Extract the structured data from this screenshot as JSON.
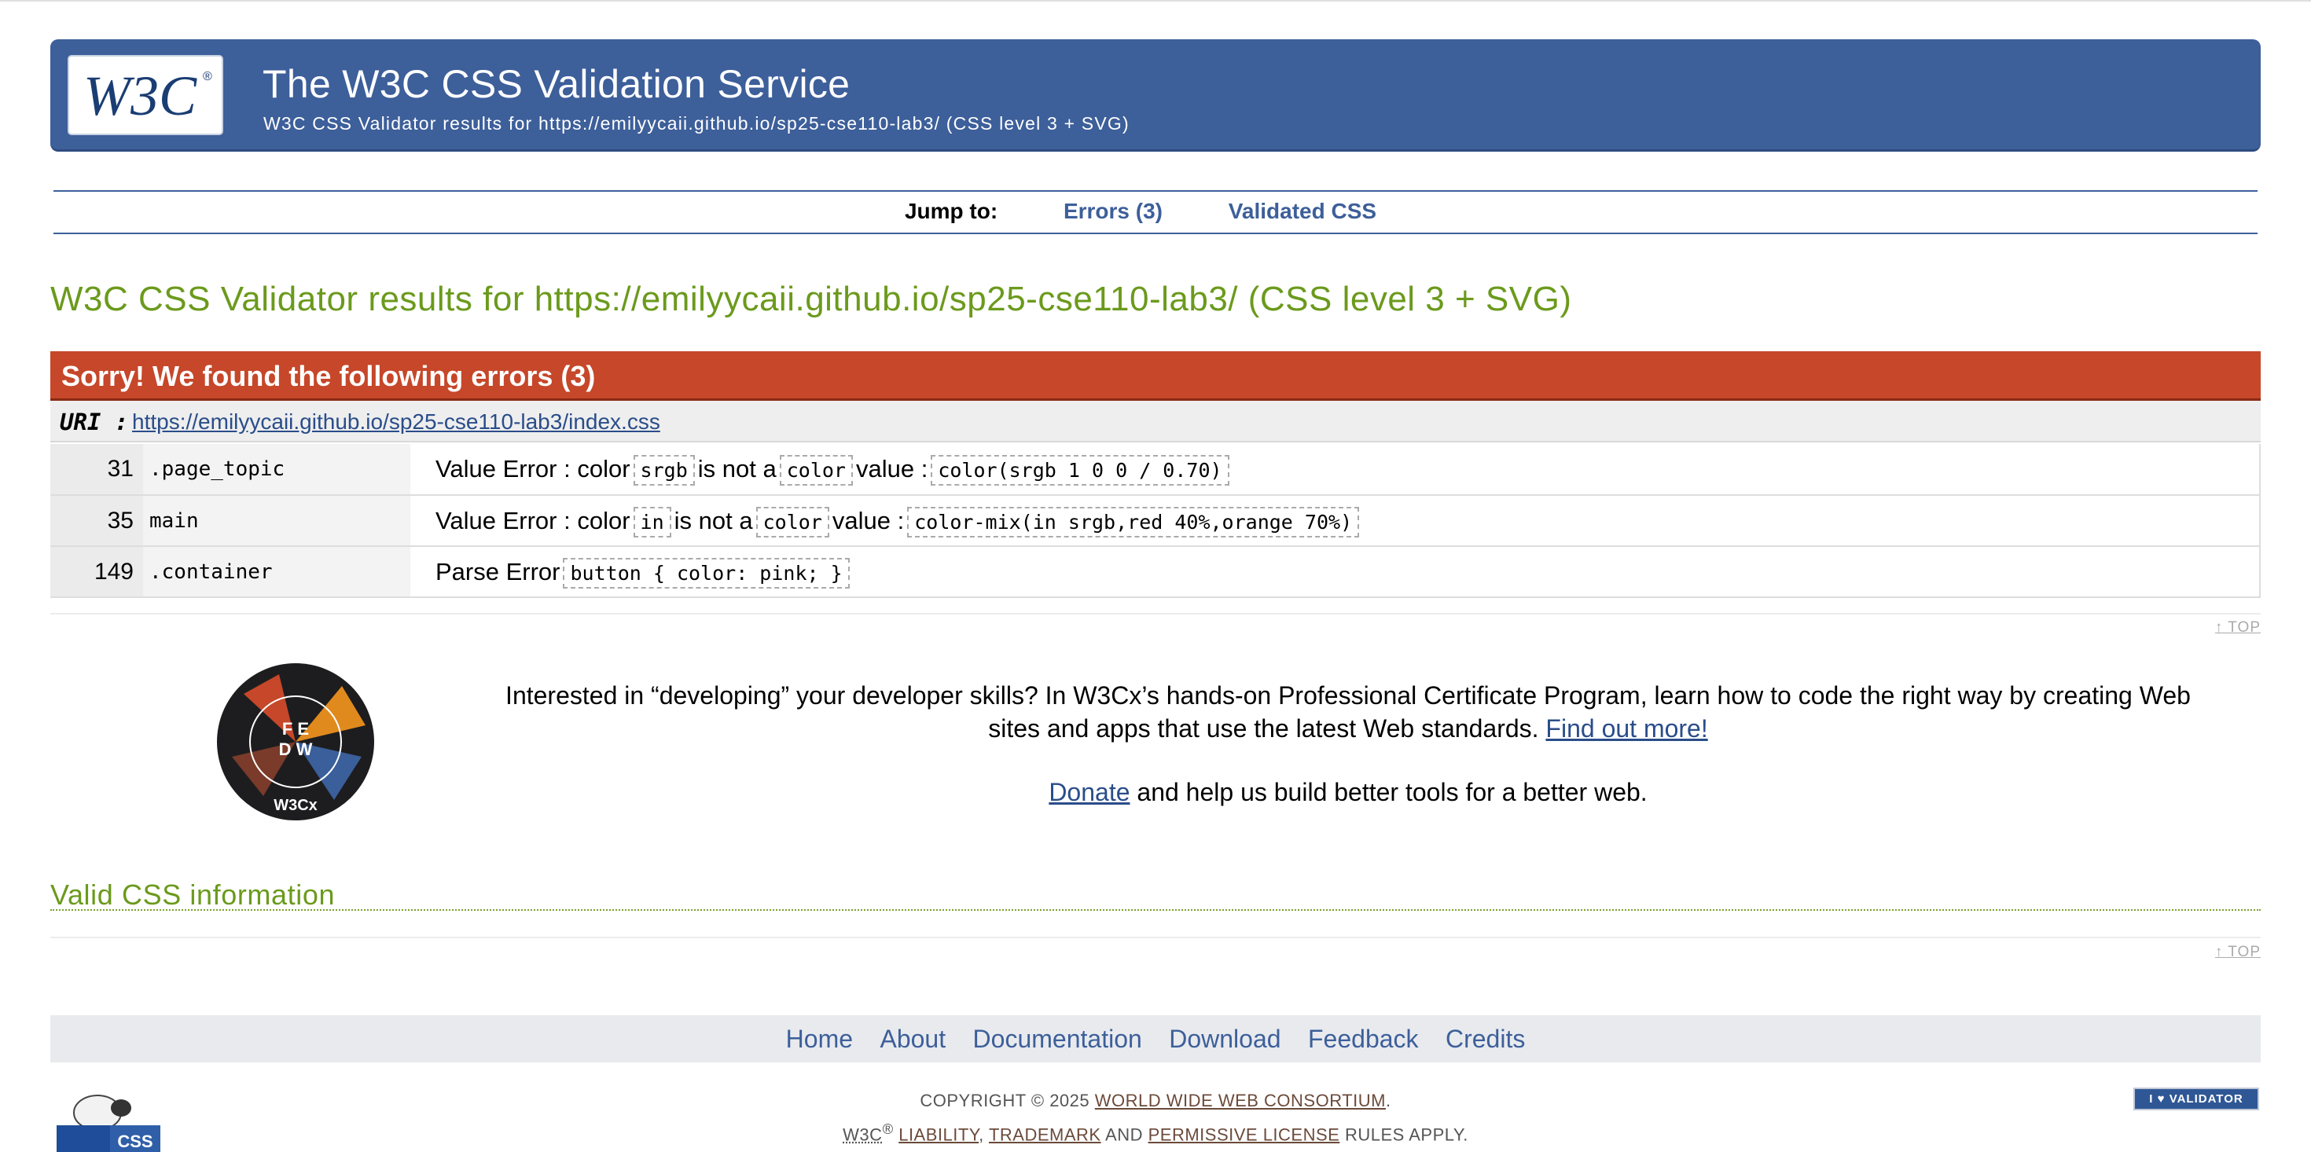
{
  "banner": {
    "logo_text": "W3C",
    "title": "The W3C CSS Validation Service",
    "subtitle": "W3C CSS Validator results for https://emilyycaii.github.io/sp25-cse110-lab3/ (CSS level 3 + SVG)"
  },
  "jump": {
    "label": "Jump to:",
    "links": [
      "Errors (3)",
      "Validated CSS"
    ]
  },
  "results_heading": "W3C CSS Validator results for https://emilyycaii.github.io/sp25-cse110-lab3/ (CSS level 3 + SVG)",
  "errors": {
    "heading": "Sorry! We found the following errors (3)",
    "uri_label": "URI :",
    "uri": "https://emilyycaii.github.io/sp25-cse110-lab3/index.css",
    "rows": [
      {
        "line": "31",
        "context": ".page_topic",
        "type": "Value Error :",
        "w1": "color",
        "code1": "srgb",
        "w2": "is not a",
        "code2": "color",
        "w3": "value :",
        "code3": "color(srgb 1 0 0 / 0.70)"
      },
      {
        "line": "35",
        "context": "main",
        "type": "Value Error :",
        "w1": "color",
        "code1": "in",
        "w2": "is not a",
        "code2": "color",
        "w3": "value :",
        "code3": "color-mix(in srgb,red 40%,orange 70%)"
      },
      {
        "line": "149",
        "context": ".container",
        "type": "Parse Error",
        "code1": "button { color: pink; }"
      }
    ]
  },
  "top_link": "↑ TOP",
  "promo": {
    "badge_text": "W3Cx",
    "text": "Interested in “developing” your developer skills? In W3Cx’s hands-on Professional Certificate Program, learn how to code the right way by creating Web sites and apps that use the latest Web standards.",
    "link": "Find out more!",
    "donate_link": "Donate",
    "donate_text": "and help us build better tools for a better web."
  },
  "valid_heading": "Valid CSS information",
  "footer": {
    "nav": [
      "Home",
      "About",
      "Documentation",
      "Download",
      "Feedback",
      "Credits"
    ],
    "copyright_prefix": "COPYRIGHT © 2025",
    "consortium": "WORLD WIDE WEB CONSORTIUM",
    "w3c": "W3C",
    "reg": "®",
    "liability": "LIABILITY",
    "trademark": "TRADEMARK",
    "and": "AND",
    "license": "PERMISSIVE LICENSE",
    "rules": "RULES APPLY.",
    "sheep_label": "CSS",
    "validator_badge": "I ♥ VALIDATOR"
  },
  "colors": {
    "banner": "#3d5f9a",
    "error_header": "#c64729",
    "heading_green": "#6b9a1c",
    "link": "#2a4d8a"
  }
}
